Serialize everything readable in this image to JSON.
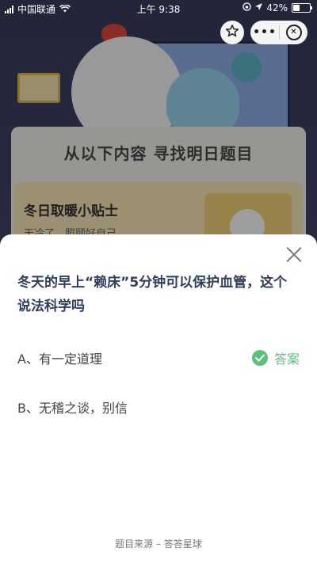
{
  "status_bar": {
    "carrier": "中国联通",
    "time": "上午 9:38",
    "battery": "42%",
    "battery_level": 0.42
  },
  "background": {
    "card_title": "从以下内容  寻找明日题目",
    "tip_title": "冬日取暖小贴士",
    "tip_text": "天冷了，照顾好自己"
  },
  "sheet": {
    "question": "冬天的早上“赖床”5分钟可以保护血管，这个说法科学吗",
    "options": [
      {
        "label": "A、有一定道理",
        "is_answer": true
      },
      {
        "label": "B、无稽之谈，别信",
        "is_answer": false
      }
    ],
    "answer_label": "答案",
    "footer": "题目来源 – 答答星球"
  },
  "colors": {
    "answer_green": "#5cc07a",
    "question_text": "#2f3e5b"
  },
  "icons": {
    "favorite": "star-outline-icon",
    "menu": "more-dots-icon",
    "close": "circle-close-icon"
  }
}
